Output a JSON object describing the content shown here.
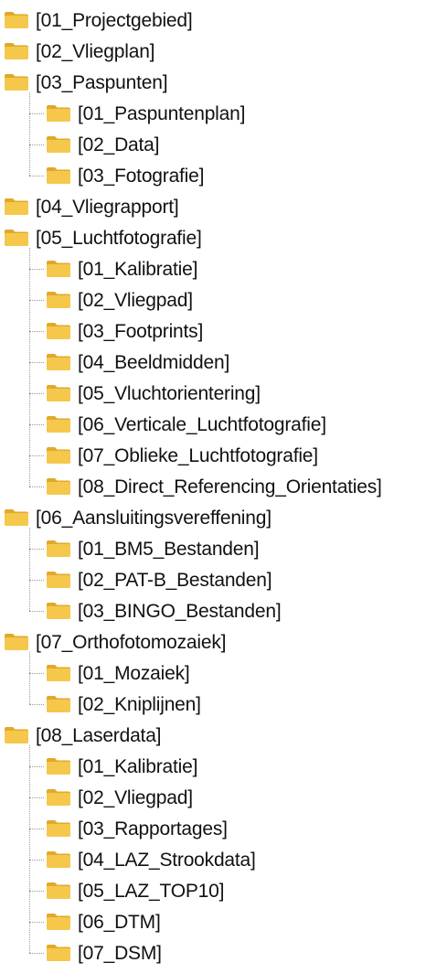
{
  "folder_color": "#F5C84C",
  "folder_shade": "#E0A92A",
  "items": [
    {
      "label": "[01_Projectgebied]",
      "level": 0
    },
    {
      "label": "[02_Vliegplan]",
      "level": 0
    },
    {
      "label": "[03_Paspunten]",
      "level": 0
    },
    {
      "label": "[01_Paspuntenplan]",
      "level": 1
    },
    {
      "label": "[02_Data]",
      "level": 1
    },
    {
      "label": "[03_Fotografie]",
      "level": 1
    },
    {
      "label": "[04_Vliegrapport]",
      "level": 0
    },
    {
      "label": "[05_Luchtfotografie]",
      "level": 0
    },
    {
      "label": "[01_Kalibratie]",
      "level": 1
    },
    {
      "label": "[02_Vliegpad]",
      "level": 1
    },
    {
      "label": "[03_Footprints]",
      "level": 1
    },
    {
      "label": "[04_Beeldmidden]",
      "level": 1
    },
    {
      "label": "[05_Vluchtorientering]",
      "level": 1
    },
    {
      "label": "[06_Verticale_Luchtfotografie]",
      "level": 1
    },
    {
      "label": "[07_Oblieke_Luchtfotografie]",
      "level": 1
    },
    {
      "label": "[08_Direct_Referencing_Orientaties]",
      "level": 1
    },
    {
      "label": "[06_Aansluitingsvereffening]",
      "level": 0
    },
    {
      "label": "[01_BM5_Bestanden]",
      "level": 1
    },
    {
      "label": "[02_PAT-B_Bestanden]",
      "level": 1
    },
    {
      "label": "[03_BINGO_Bestanden]",
      "level": 1
    },
    {
      "label": "[07_Orthofotomozaiek]",
      "level": 0
    },
    {
      "label": "[01_Mozaiek]",
      "level": 1
    },
    {
      "label": "[02_Kniplijnen]",
      "level": 1
    },
    {
      "label": "[08_Laserdata]",
      "level": 0
    },
    {
      "label": "[01_Kalibratie]",
      "level": 1
    },
    {
      "label": "[02_Vliegpad]",
      "level": 1
    },
    {
      "label": "[03_Rapportages]",
      "level": 1
    },
    {
      "label": "[04_LAZ_Strookdata]",
      "level": 1
    },
    {
      "label": "[05_LAZ_TOP10]",
      "level": 1
    },
    {
      "label": "[06_DTM]",
      "level": 1
    },
    {
      "label": "[07_DSM]",
      "level": 1
    }
  ]
}
